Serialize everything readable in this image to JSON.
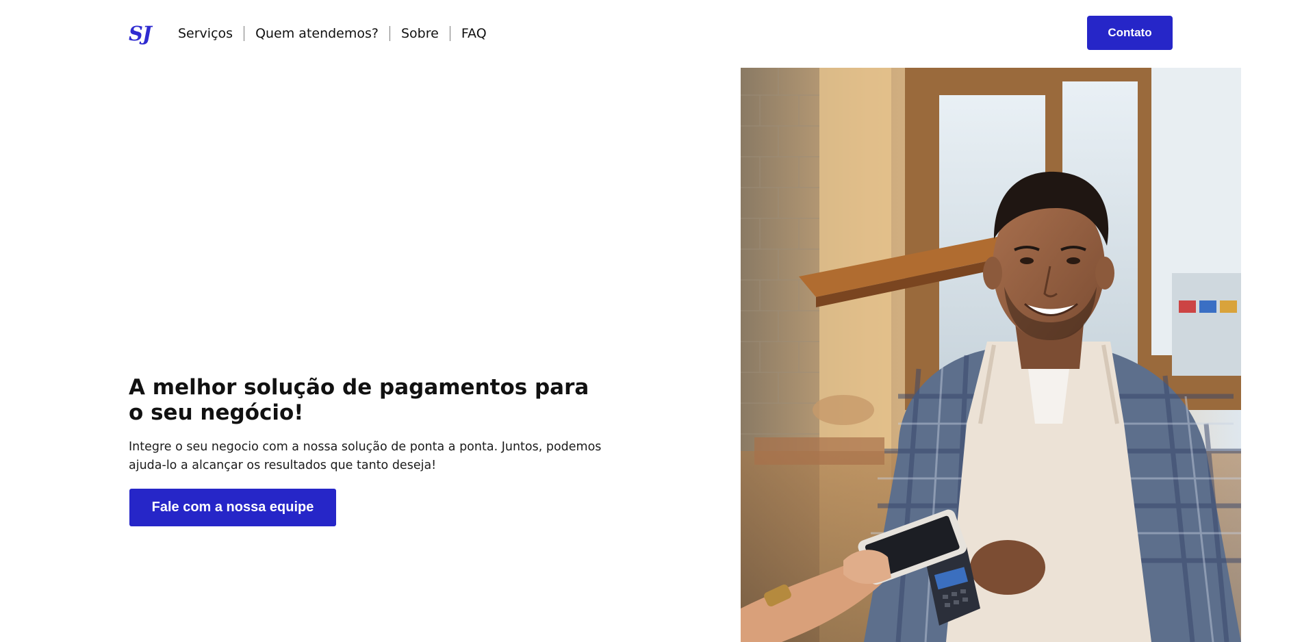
{
  "header": {
    "logo_text": "SJ",
    "nav": [
      {
        "label": "Serviços"
      },
      {
        "label": "Quem atendemos?"
      },
      {
        "label": "Sobre"
      },
      {
        "label": "FAQ"
      }
    ],
    "contact_label": "Contato"
  },
  "hero": {
    "title": "A melhor solução de pagamentos para o seu negócio!",
    "text": "Integre o seu negocio com a nossa solução de ponta a ponta. Juntos, podemos ajuda-lo a alcançar os resultados que tanto deseja!",
    "cta_label": "Fale com a nossa equipe",
    "image_icon": "merchant-payment-photo"
  },
  "colors": {
    "brand": "#2626c8",
    "text": "#111111",
    "background": "#ffffff"
  }
}
